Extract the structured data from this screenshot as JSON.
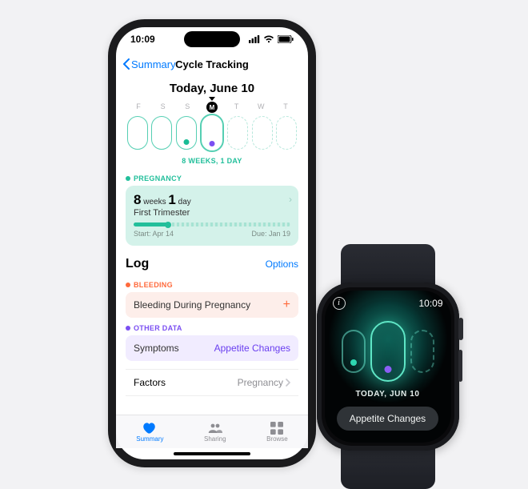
{
  "phone": {
    "status_time": "10:09",
    "nav": {
      "back": "Summary",
      "title": "Cycle Tracking"
    },
    "today_heading": "Today, June 10",
    "days": [
      "F",
      "S",
      "S",
      "M",
      "T",
      "W",
      "T"
    ],
    "today_index": 3,
    "today_letter": "M",
    "weeks_line": "8 WEEKS, 1 DAY",
    "pregnancy": {
      "label": "PREGNANCY",
      "weeks_n": "8",
      "weeks_unit": "weeks",
      "days_n": "1",
      "days_unit": "day",
      "trimester": "First Trimester",
      "start_label": "Start: Apr 14",
      "due_label": "Due: Jan 19",
      "progress_pct": 22
    },
    "log": {
      "title": "Log",
      "options": "Options",
      "bleeding_label": "BLEEDING",
      "bleeding_row": "Bleeding During Pregnancy",
      "other_label": "OTHER DATA",
      "symptoms_label": "Symptoms",
      "symptoms_value": "Appetite Changes",
      "factors_label": "Factors",
      "factors_value": "Pregnancy"
    },
    "tabs": {
      "summary": "Summary",
      "sharing": "Sharing",
      "browse": "Browse"
    }
  },
  "watch": {
    "time": "10:09",
    "today": "TODAY, JUN 10",
    "button": "Appetite Changes"
  },
  "colors": {
    "teal": "#22bf9b",
    "violet": "#7b4ff2",
    "orange": "#ff6a3c",
    "ios_blue": "#007aff"
  }
}
